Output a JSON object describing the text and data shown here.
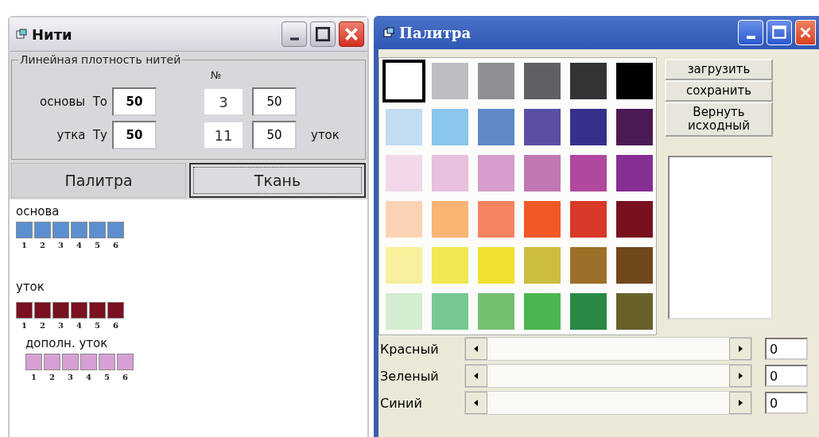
{
  "threads_window": {
    "title": "Нити",
    "density_group": {
      "legend": "Линейная плотность нитей",
      "number_heading": "№",
      "warp_label": "основы  То",
      "warp_value": "50",
      "weft_label": "утка  Ту",
      "weft_value": "50",
      "extra_rows": [
        {
          "number": "3",
          "value": "50",
          "label": ""
        },
        {
          "number": "11",
          "value": "50",
          "label": "уток"
        }
      ]
    },
    "tabs": [
      {
        "label": "Палитра",
        "selected": false
      },
      {
        "label": "Ткань",
        "selected": true
      }
    ],
    "thread_sets": [
      {
        "label": "основа",
        "color": "#5b8fd0",
        "numbers": [
          "1",
          "2",
          "3",
          "4",
          "5",
          "6"
        ]
      },
      {
        "label": "уток",
        "color": "#7a1020",
        "numbers": [
          "1",
          "2",
          "3",
          "4",
          "5",
          "6"
        ]
      },
      {
        "label": "дополн. уток",
        "color": "#d7a0d4",
        "numbers": [
          "1",
          "2",
          "3",
          "4",
          "5",
          "6"
        ]
      }
    ]
  },
  "palette_window": {
    "title": "Палитра",
    "swatches": [
      {
        "color": "#ffffff",
        "selected": true
      },
      {
        "color": "#bcbec2",
        "selected": false
      },
      {
        "color": "#8e9094",
        "selected": false
      },
      {
        "color": "#5f6064",
        "selected": false
      },
      {
        "color": "#323335",
        "selected": false
      },
      {
        "color": "#000000",
        "selected": false
      },
      {
        "color": "#c2dcf2",
        "selected": false
      },
      {
        "color": "#8ac6ee",
        "selected": false
      },
      {
        "color": "#5e88c8",
        "selected": false
      },
      {
        "color": "#5a4fa4",
        "selected": false
      },
      {
        "color": "#36308c",
        "selected": false
      },
      {
        "color": "#4c1a54",
        "selected": false
      },
      {
        "color": "#f2d8ea",
        "selected": false
      },
      {
        "color": "#e8c0de",
        "selected": false
      },
      {
        "color": "#d69ccc",
        "selected": false
      },
      {
        "color": "#c078b4",
        "selected": false
      },
      {
        "color": "#b0489e",
        "selected": false
      },
      {
        "color": "#862e94",
        "selected": false
      },
      {
        "color": "#fcd2b4",
        "selected": false
      },
      {
        "color": "#fcb474",
        "selected": false
      },
      {
        "color": "#f48460",
        "selected": false
      },
      {
        "color": "#f05828",
        "selected": false
      },
      {
        "color": "#d83828",
        "selected": false
      },
      {
        "color": "#781020",
        "selected": false
      },
      {
        "color": "#f8f09c",
        "selected": false
      },
      {
        "color": "#f0e850",
        "selected": false
      },
      {
        "color": "#f0e030",
        "selected": false
      },
      {
        "color": "#ccbc40",
        "selected": false
      },
      {
        "color": "#9c7028",
        "selected": false
      },
      {
        "color": "#70481c",
        "selected": false
      },
      {
        "color": "#d4ecd0",
        "selected": false
      },
      {
        "color": "#78c894",
        "selected": false
      },
      {
        "color": "#74c070",
        "selected": false
      },
      {
        "color": "#4cb450",
        "selected": false
      },
      {
        "color": "#288a44",
        "selected": false
      },
      {
        "color": "#68622a",
        "selected": false
      }
    ],
    "buttons": [
      "загрузить",
      "сохранить",
      "Вернуть исходный"
    ],
    "sliders": [
      {
        "label": "Красный",
        "value": "0"
      },
      {
        "label": "Зеленый",
        "value": "0"
      },
      {
        "label": "Синий",
        "value": "0"
      }
    ]
  }
}
